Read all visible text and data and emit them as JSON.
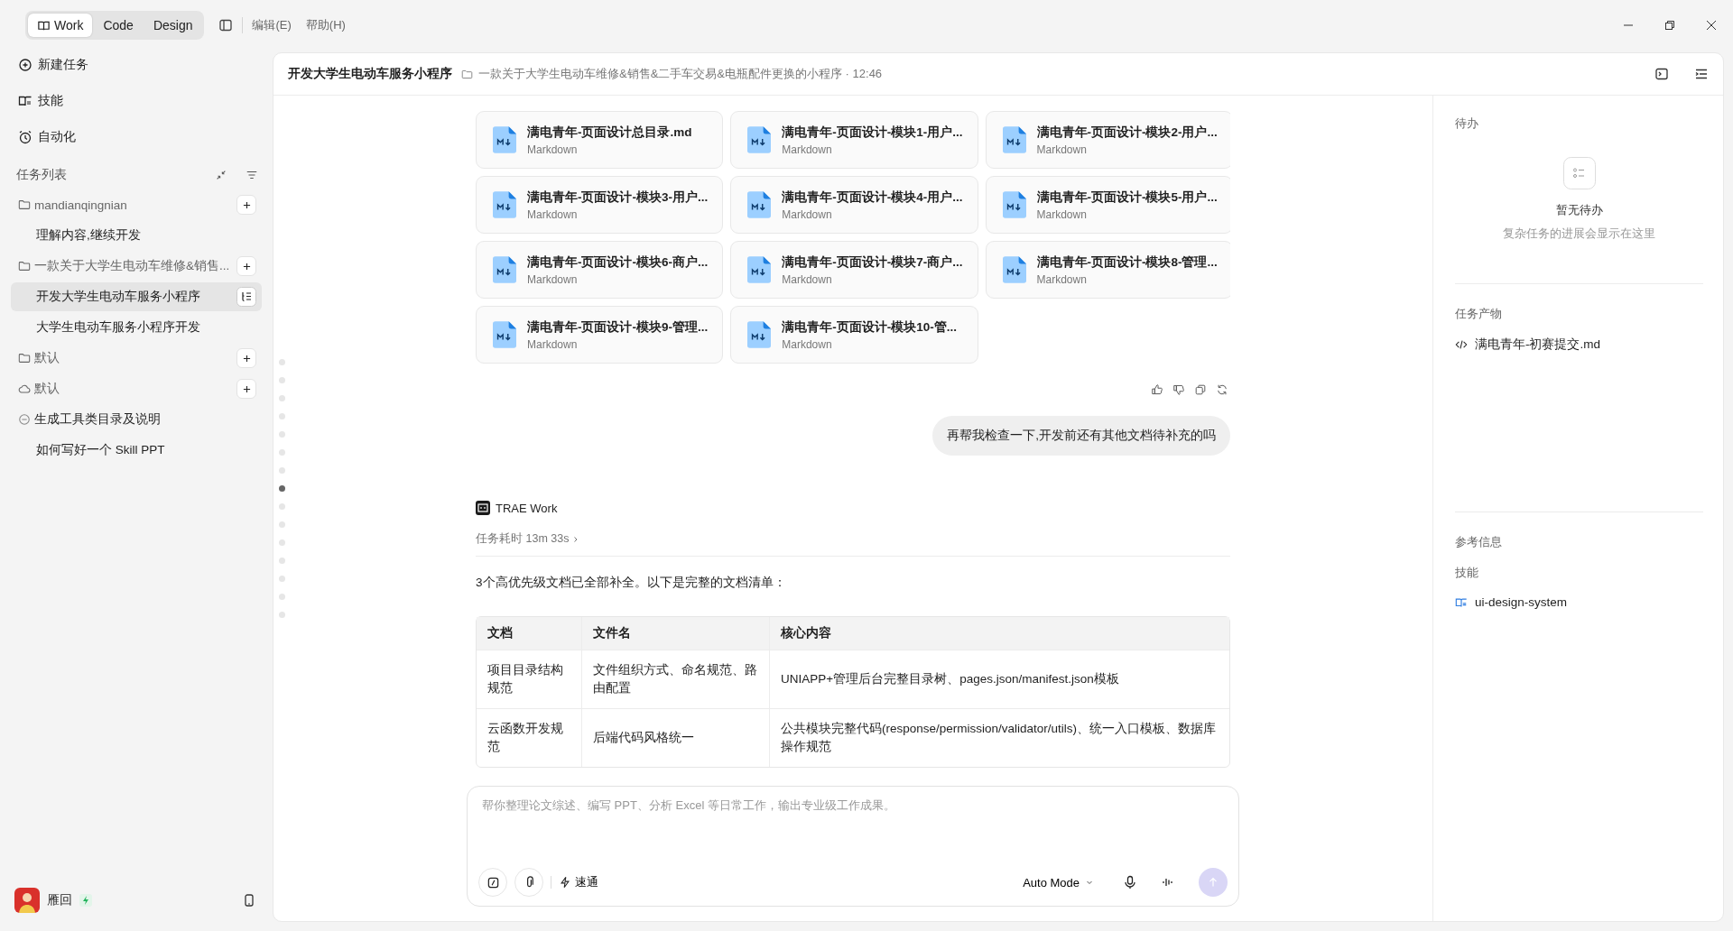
{
  "top_bar": {
    "mode_tabs": [
      {
        "label": "Work",
        "selected": true
      },
      {
        "label": "Code",
        "selected": false
      },
      {
        "label": "Design",
        "selected": false
      }
    ],
    "menu": [
      "编辑(E)",
      "帮助(H)"
    ]
  },
  "sidebar": {
    "nav": [
      {
        "kind": "new",
        "label": "新建任务"
      },
      {
        "kind": "skills",
        "label": "技能"
      },
      {
        "kind": "automation",
        "label": "自动化"
      }
    ],
    "task_list_title": "任务列表",
    "groups": [
      {
        "kind": "folder",
        "name": "mandianqingnian",
        "children": [
          {
            "label": "理解内容,继续开发",
            "selected": false
          }
        ]
      },
      {
        "kind": "folder",
        "name": "一款关于大学生电动车维修&销售...",
        "children": [
          {
            "label": "开发大学生电动车服务小程序",
            "selected": true
          },
          {
            "label": "大学生电动车服务小程序开发",
            "selected": false
          }
        ]
      },
      {
        "kind": "folder",
        "name": "默认"
      },
      {
        "kind": "cloud",
        "name": "默认"
      },
      {
        "kind": "task",
        "name": "生成工具类目录及说明",
        "children": [
          {
            "label": "如何写好一个 Skill PPT",
            "selected": false
          }
        ]
      }
    ],
    "user": {
      "name": "雁回"
    }
  },
  "header": {
    "title": "开发大学生电动车服务小程序",
    "project": "一款关于大学生电动车维修&销售&二手车交易&电瓶配件更换的小程序 · 12:46"
  },
  "chat": {
    "files": [
      {
        "name": "满电青年-页面设计总目录.md",
        "type": "Markdown"
      },
      {
        "name": "满电青年-页面设计-模块1-用户...",
        "type": "Markdown"
      },
      {
        "name": "满电青年-页面设计-模块2-用户...",
        "type": "Markdown"
      },
      {
        "name": "满电青年-页面设计-模块3-用户...",
        "type": "Markdown"
      },
      {
        "name": "满电青年-页面设计-模块4-用户...",
        "type": "Markdown"
      },
      {
        "name": "满电青年-页面设计-模块5-用户...",
        "type": "Markdown"
      },
      {
        "name": "满电青年-页面设计-模块6-商户...",
        "type": "Markdown"
      },
      {
        "name": "满电青年-页面设计-模块7-商户...",
        "type": "Markdown"
      },
      {
        "name": "满电青年-页面设计-模块8-管理...",
        "type": "Markdown"
      },
      {
        "name": "满电青年-页面设计-模块9-管理...",
        "type": "Markdown"
      },
      {
        "name": "满电青年-页面设计-模块10-管...",
        "type": "Markdown"
      }
    ],
    "user_message": "再帮我检查一下,开发前还有其他文档待补充的吗",
    "assistant": {
      "name": "TRAE Work",
      "duration": "任务耗时 13m 33s",
      "text": "3个高优先级文档已全部补全。以下是完整的文档清单：",
      "table": {
        "columns": [
          "文档",
          "文件名",
          "核心内容"
        ],
        "rows": [
          [
            "项目目录结构规范",
            "文件组织方式、命名规范、路由配置",
            "UNIAPP+管理后台完整目录树、pages.json/manifest.json模板"
          ],
          [
            "云函数开发规范",
            "后端代码风格统一",
            "公共模块完整代码(response/permission/validator/utils)、统一入口模板、数据库操作规范"
          ]
        ]
      }
    }
  },
  "timeline_dots": [
    {
      "selected": false
    },
    {
      "selected": false
    },
    {
      "selected": false
    },
    {
      "selected": false
    },
    {
      "selected": false
    },
    {
      "selected": false
    },
    {
      "selected": false
    },
    {
      "selected": true
    },
    {
      "selected": false
    },
    {
      "selected": false
    },
    {
      "selected": false
    },
    {
      "selected": false
    },
    {
      "selected": false
    },
    {
      "selected": false
    },
    {
      "selected": false
    }
  ],
  "composer": {
    "placeholder": "帮你整理论文综述、编写 PPT、分析 Excel 等日常工作，输出专业级工作成果。",
    "speed_label": "速通",
    "mode": "Auto Mode"
  },
  "right_panel": {
    "todo_title": "待办",
    "empty_title": "暂无待办",
    "empty_hint": "复杂任务的进展会显示在这里",
    "artifacts_title": "任务产物",
    "artifacts": [
      "满电青年-初赛提交.md"
    ],
    "reference_title": "参考信息",
    "skills_title": "技能",
    "skills": [
      "ui-design-system"
    ]
  }
}
